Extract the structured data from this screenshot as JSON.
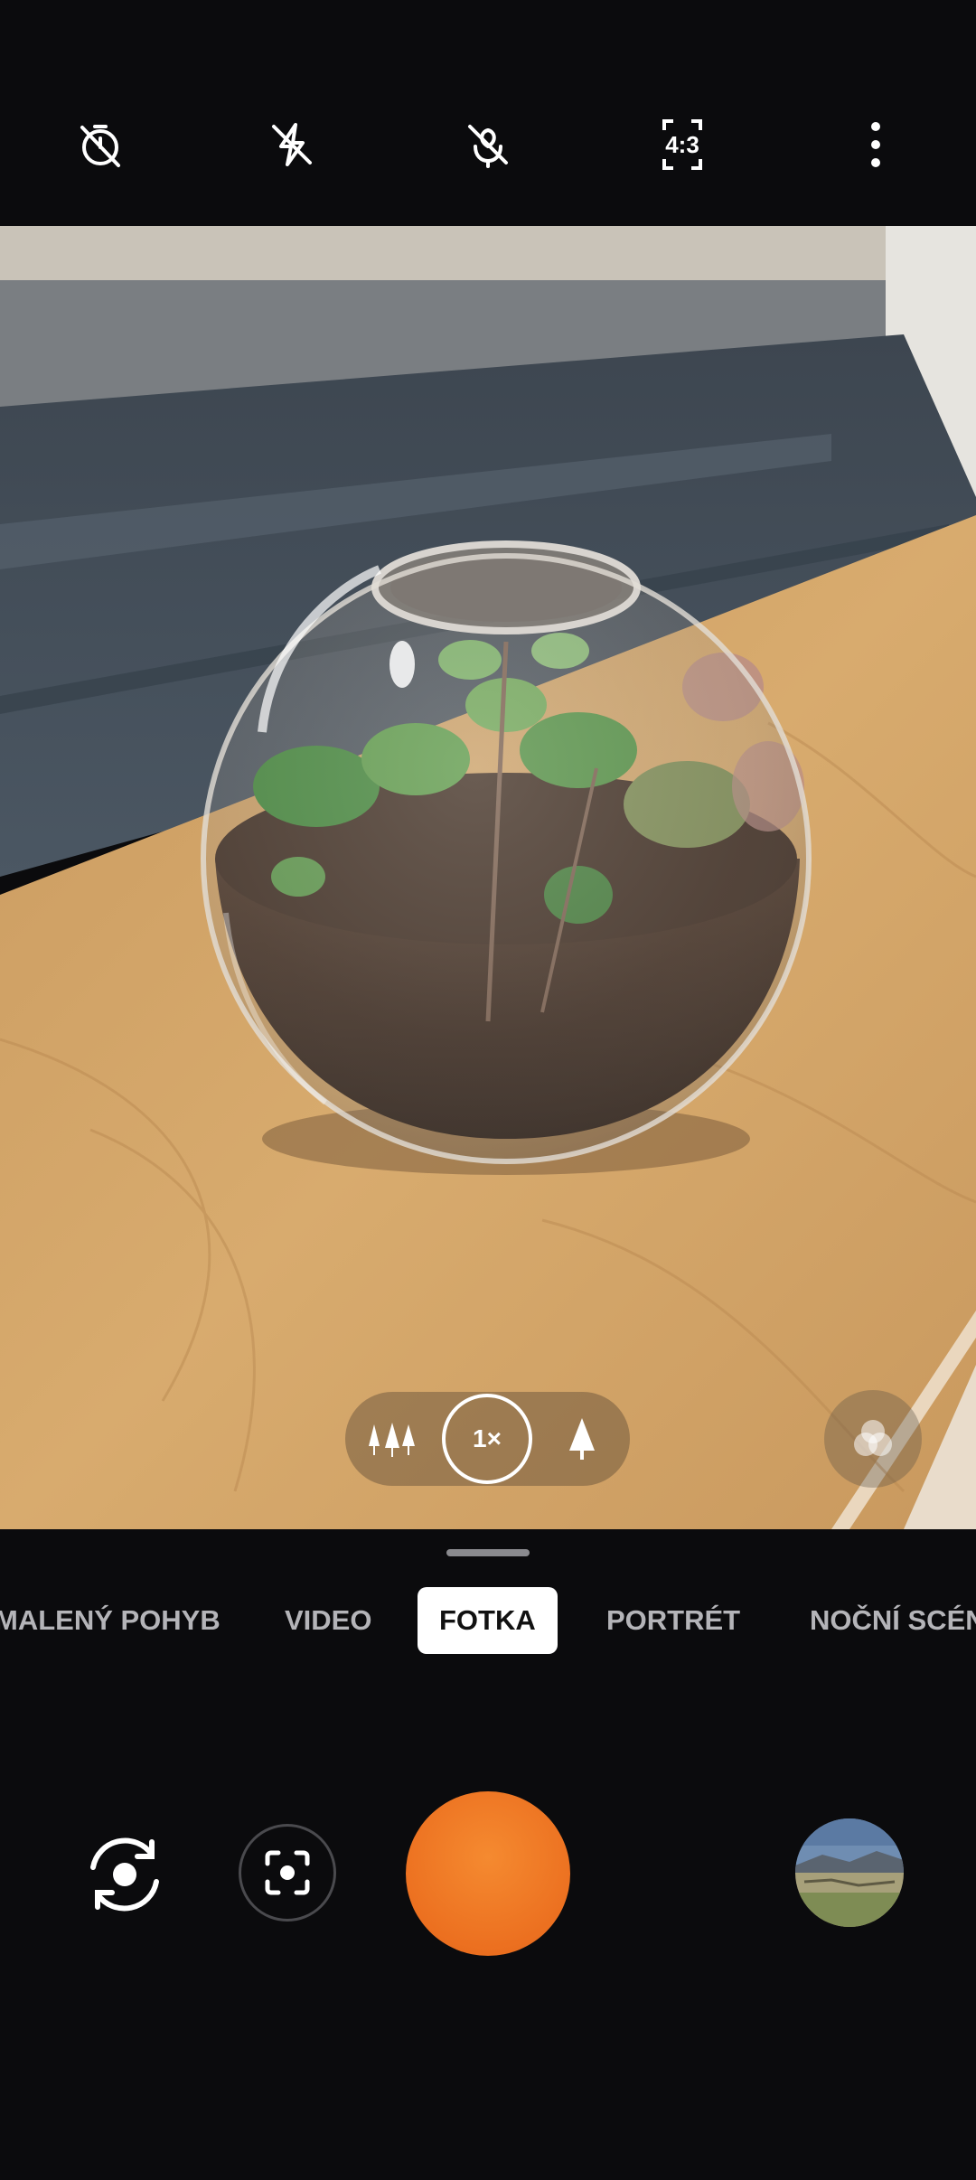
{
  "top_toolbar": {
    "timer_icon": "timer-off-icon",
    "flash_icon": "flash-off-icon",
    "macro_icon": "macro-off-icon",
    "aspect_ratio_label": "4:3",
    "more_icon": "more-vertical-icon"
  },
  "zoom": {
    "wide_icon": "trees-wide-icon",
    "current_label": "1×",
    "tele_icon": "tree-tele-icon"
  },
  "filters_icon": "filters-icon",
  "modes": {
    "items": [
      "MALENÝ POHYB",
      "VIDEO",
      "FOTKA",
      "PORTRÉT",
      "NOČNÍ SCÉNA"
    ],
    "selected": "FOTKA"
  },
  "controls": {
    "flip_icon": "switch-camera-icon",
    "lens_icon": "google-lens-icon",
    "shutter_color": "#ec7020",
    "gallery_thumbnail": "gallery-thumbnail"
  }
}
